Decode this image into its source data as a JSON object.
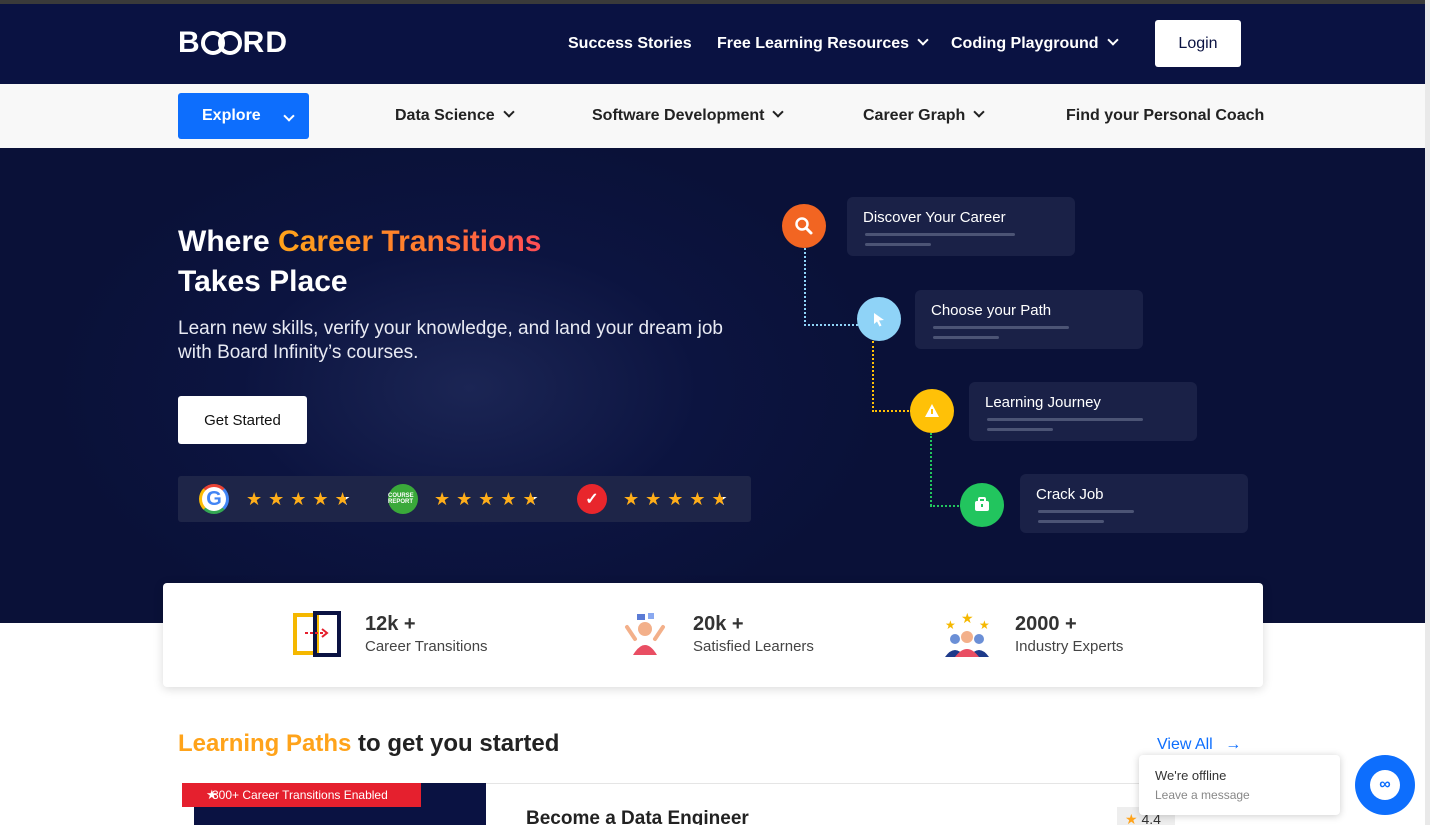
{
  "brand": {
    "logo_text_left": "B",
    "logo_text_right": "RD"
  },
  "topnav": {
    "success_stories": "Success Stories",
    "free_learning": "Free Learning Resources",
    "coding_playground": "Coding Playground",
    "login": "Login"
  },
  "subnav": {
    "explore": "Explore",
    "data_science": "Data Science",
    "software_dev": "Software Development",
    "career_graph": "Career Graph",
    "personal_coach": "Find your Personal Coach"
  },
  "hero": {
    "title_a": "Where ",
    "title_accent": "Career Transitions",
    "title_b": "Takes Place",
    "subtitle": "Learn new skills, verify your knowledge, and land your dream job with Board Infinity’s courses.",
    "cta": "Get Started",
    "ratings": [
      {
        "source_icon": "google-icon",
        "stars": 4.5
      },
      {
        "source_icon": "course-report-icon",
        "label": "COURSE REPORT",
        "stars": 4.5
      },
      {
        "source_icon": "switchup-icon",
        "stars": 4.5
      }
    ]
  },
  "career_steps": [
    {
      "label": "Discover Your Career",
      "icon": "search-icon",
      "color": "#f26522"
    },
    {
      "label": "Choose your Path",
      "icon": "cursor-icon",
      "color": "#8fd3f7"
    },
    {
      "label": "Learning Journey",
      "icon": "flag-icon",
      "color": "#ffc107"
    },
    {
      "label": "Crack Job",
      "icon": "briefcase-icon",
      "color": "#22c55e"
    }
  ],
  "stats": [
    {
      "number": "12k +",
      "caption": "Career Transitions",
      "icon": "transition-door-icon"
    },
    {
      "number": "20k +",
      "caption": "Satisfied Learners",
      "icon": "happy-learner-icon"
    },
    {
      "number": "2000 +",
      "caption": "Industry Experts",
      "icon": "experts-group-icon"
    }
  ],
  "learning_paths": {
    "title_accent": "Learning Paths",
    "title_rest": " to get you started",
    "view_all": "View All",
    "course": {
      "ribbon": "300+ Career Transitions Enabled",
      "title": "Become a Data Engineer",
      "rating": "4.4"
    }
  },
  "chat": {
    "status": "We're offline",
    "prompt": "Leave a message"
  },
  "colors": {
    "navy": "#0a1242",
    "accent_blue": "#0d6efd",
    "accent_orange": "#ffa31a",
    "ribbon_red": "#e5202e"
  }
}
